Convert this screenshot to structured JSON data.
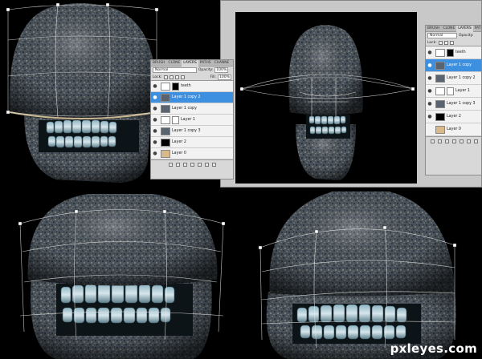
{
  "watermark": "pxleyes.com",
  "palette_small": {
    "tabs": [
      "BRUSH",
      "CLONE",
      "LAYERS",
      "PATHS",
      "CHANNE"
    ],
    "active_tab": "LAYERS",
    "blend_mode": "Normal",
    "opacity_label": "Opacity:",
    "opacity_value": "100%",
    "lock_label": "Lock:",
    "fill_label": "Fill:",
    "fill_value": "100%",
    "layers": [
      {
        "name": "teeth",
        "thumb": "mask",
        "selected": false,
        "visible": true
      },
      {
        "name": "Layer 1 copy 2",
        "thumb": "stone",
        "selected": true,
        "visible": true
      },
      {
        "name": "Layer 1 copy",
        "thumb": "stone",
        "selected": false,
        "visible": true
      },
      {
        "name": "Layer 1",
        "thumb": "mask",
        "selected": false,
        "visible": true
      },
      {
        "name": "Layer 1 copy 3",
        "thumb": "stone",
        "selected": false,
        "visible": true
      },
      {
        "name": "Layer 2",
        "thumb": "black",
        "selected": false,
        "visible": true
      },
      {
        "name": "Layer 0",
        "thumb": "photo",
        "selected": false,
        "visible": true
      }
    ]
  },
  "palette_large": {
    "tabs": [
      "BRUSH",
      "CLONE",
      "LAYERS",
      "PATHS",
      "CHANNE"
    ],
    "active_tab": "LAYERS",
    "blend_mode": "Normal",
    "opacity_label": "Opacity:",
    "opacity_value": "100%",
    "lock_label": "Lock:",
    "fill_label": "Fill:",
    "fill_value": "100%",
    "layers": [
      {
        "name": "teeth",
        "thumb": "mask",
        "selected": false,
        "visible": true
      },
      {
        "name": "Layer 1 copy",
        "thumb": "stone",
        "selected": true,
        "visible": true
      },
      {
        "name": "Layer 1 copy 2",
        "thumb": "stone",
        "selected": false,
        "visible": true
      },
      {
        "name": "Layer 1",
        "thumb": "mask",
        "selected": false,
        "visible": true
      },
      {
        "name": "Layer 1 copy 3",
        "thumb": "stone",
        "selected": false,
        "visible": true
      },
      {
        "name": "Layer 2",
        "thumb": "black",
        "selected": false,
        "visible": true
      },
      {
        "name": "Layer 0",
        "thumb": "photo",
        "selected": false,
        "visible": false
      }
    ]
  },
  "colors": {
    "background": "#000000",
    "ui_gray": "#d8d8d8",
    "selection_blue": "#3d8fe0",
    "stone_dark": "#3e4650",
    "stone_light": "#8a8a82",
    "teeth": "#c9d8df",
    "warp_grid": "#e8e8e8"
  }
}
